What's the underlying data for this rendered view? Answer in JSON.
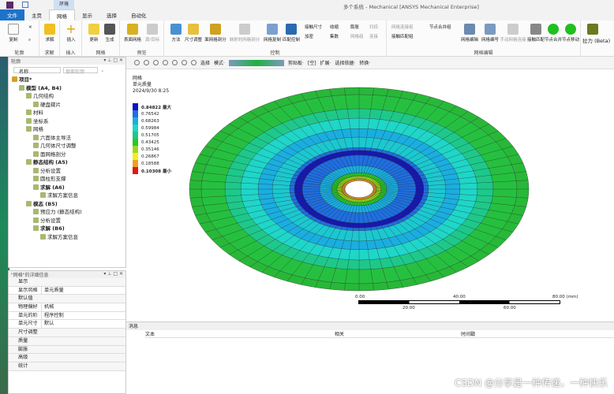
{
  "window": {
    "title": "多个系统 - Mechanical [ANSYS Mechanical Enterprise]",
    "context_tab": "环境"
  },
  "tabs": [
    "文件",
    "主页",
    "网格",
    "显示",
    "选择",
    "自动化"
  ],
  "ribbon": {
    "groups": [
      {
        "label": "轮廓",
        "buttons": [
          "复制"
        ]
      },
      {
        "label": "求解",
        "buttons": [
          "求解"
        ]
      },
      {
        "label": "插入",
        "buttons": [
          "插入"
        ]
      },
      {
        "label": "网格",
        "buttons": [
          "更新",
          "生成"
        ]
      },
      {
        "label": "预览",
        "buttons": [
          "表面网格",
          "源/目标"
        ]
      },
      {
        "label": "控制",
        "buttons": [
          "方法",
          "尺寸调整",
          "面网格剖分",
          "映射的网格剖分",
          "网格复制",
          "匹配控制"
        ],
        "small": [
          "接触尺寸",
          "收缩",
          "膨胀",
          "加密",
          "集数",
          "网格组",
          "扫掠",
          "连接"
        ]
      },
      {
        "label": "网格编辑",
        "buttons": [
          "网格编辑",
          "网格编号",
          "手动网格连接",
          "接触匹配",
          "节点合并",
          "节点移动"
        ],
        "small": [
          "网格连接组",
          "接触匹配组",
          "节点合并组"
        ]
      },
      {
        "label": "",
        "buttons": [
          "拉力 (Beta)"
        ]
      }
    ]
  },
  "outline": {
    "title": "轮廓",
    "filter_name": "名称",
    "search_placeholder": "搜索轮廓",
    "items": [
      {
        "label": "项目*",
        "level": 0,
        "bold": true
      },
      {
        "label": "模型 (A4, B4)",
        "level": 1,
        "bold": true
      },
      {
        "label": "几何结构",
        "level": 2
      },
      {
        "label": "硬盘碟片",
        "level": 3
      },
      {
        "label": "材料",
        "level": 2
      },
      {
        "label": "坐标系",
        "level": 2
      },
      {
        "label": "网格",
        "level": 2
      },
      {
        "label": "六面体主导法",
        "level": 3
      },
      {
        "label": "几何体尺寸调整",
        "level": 3
      },
      {
        "label": "面网格剖分",
        "level": 3
      },
      {
        "label": "静态结构 (A5)",
        "level": 2,
        "bold": true
      },
      {
        "label": "分析设置",
        "level": 3
      },
      {
        "label": "圆柱形支撑",
        "level": 3
      },
      {
        "label": "求解 (A6)",
        "level": 3,
        "bold": true
      },
      {
        "label": "求解方案信息",
        "level": 4
      },
      {
        "label": "模态 (B5)",
        "level": 2,
        "bold": true
      },
      {
        "label": "预应力 (静态结构)",
        "level": 3
      },
      {
        "label": "分析设置",
        "level": 3
      },
      {
        "label": "求解 (B6)",
        "level": 3,
        "bold": true
      },
      {
        "label": "求解方案信息",
        "level": 4
      }
    ]
  },
  "details": {
    "title": "\"网格\"的详细信息",
    "rows": [
      {
        "group": "显示"
      },
      {
        "key": "显示风格",
        "value": "单元质量"
      },
      {
        "group": "默认值"
      },
      {
        "key": "物理偏好",
        "value": "机械"
      },
      {
        "key": "单元的阶",
        "value": "程序控制"
      },
      {
        "key": "单元尺寸",
        "value": "默认"
      },
      {
        "group": "尺寸调整"
      },
      {
        "group": "质量"
      },
      {
        "group": "膨胀"
      },
      {
        "group": "高级"
      },
      {
        "group": "统计"
      }
    ]
  },
  "graphics_toolbar": [
    "选择",
    "模式·",
    "剪贴板·",
    "[空]",
    "扩展·",
    "选择依据·",
    "转换·"
  ],
  "result": {
    "title": "网格",
    "subtitle": "单元质量",
    "date": "2024/9/30 8:25",
    "legend": [
      {
        "value": "0.84822 最大",
        "color": "#1010c8"
      },
      {
        "value": "0.76542",
        "color": "#1f6fe0"
      },
      {
        "value": "0.68263",
        "color": "#1aaee0"
      },
      {
        "value": "0.59984",
        "color": "#1fd6c8"
      },
      {
        "value": "0.51705",
        "color": "#1ec88a"
      },
      {
        "value": "0.43425",
        "color": "#28c828"
      },
      {
        "value": "0.35146",
        "color": "#9ed81e"
      },
      {
        "value": "0.26867",
        "color": "#f0f020"
      },
      {
        "value": "0.18588",
        "color": "#f0a020"
      },
      {
        "value": "0.10308 最小",
        "color": "#e01818"
      }
    ]
  },
  "scale": {
    "top": [
      "0.00",
      "40.00",
      "80.00 (mm)"
    ],
    "bottom": [
      "20.00",
      "60.00"
    ]
  },
  "messages": {
    "title": "消息",
    "columns": [
      "文本",
      "相关",
      "时间戳"
    ]
  },
  "watermark": "CSDN @分享是一种传递，一种快乐"
}
